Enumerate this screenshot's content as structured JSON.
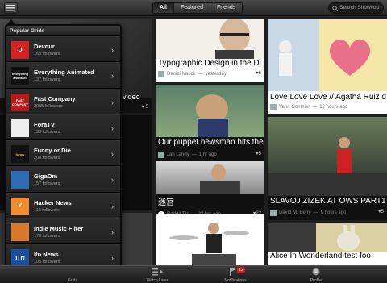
{
  "topbar": {
    "segments": [
      "All",
      "Featured",
      "Friends"
    ],
    "search_placeholder": "Search Showyou"
  },
  "popover": {
    "header": "Popular Grids",
    "items": [
      {
        "name": "Devour",
        "followers": "169 followers",
        "logo_text": "D",
        "logo_bg": "#d42222",
        "logo_fg": "#ffffff",
        "icon": "devour-logo-icon"
      },
      {
        "name": "Everything Animated",
        "followers": "137 followers",
        "logo_text": "everything animated",
        "logo_bg": "#111111",
        "logo_fg": "#ffffff",
        "icon": "everything-animated-logo-icon"
      },
      {
        "name": "Fast Company",
        "followers": "2955 followers",
        "logo_text": "FAST COMPANY",
        "logo_bg": "#b71c1c",
        "logo_fg": "#ffffff",
        "icon": "fast-company-logo-icon"
      },
      {
        "name": "ForaTV",
        "followers": "133 followers",
        "logo_text": "",
        "logo_bg": "#eeeeee",
        "logo_fg": "#333333",
        "icon": "foratv-logo-icon"
      },
      {
        "name": "Funny or Die",
        "followers": "208 followers",
        "logo_text": "funny",
        "logo_bg": "#111111",
        "logo_fg": "#f5c400",
        "icon": "funny-or-die-logo-icon"
      },
      {
        "name": "GigaOm",
        "followers": "157 followers",
        "logo_text": "",
        "logo_bg": "#2e6db4",
        "logo_fg": "#ffffff",
        "icon": "gigaom-logo-icon"
      },
      {
        "name": "Hacker News",
        "followers": "116 followers",
        "logo_text": "Y",
        "logo_bg": "#f28a30",
        "logo_fg": "#ffffff",
        "icon": "hacker-news-logo-icon"
      },
      {
        "name": "Indie Music Filter",
        "followers": "178 followers",
        "logo_text": "",
        "logo_bg": "#d9792e",
        "logo_fg": "#ffffff",
        "icon": "indie-music-filter-logo-icon"
      },
      {
        "name": "Itn News",
        "followers": "105 followers",
        "logo_text": "ITN",
        "logo_bg": "#1a4fa0",
        "logo_fg": "#ffffff",
        "icon": "itn-news-logo-icon"
      }
    ]
  },
  "cards": [
    {
      "title": "Typographic Design in the Di",
      "author": "Daniel Nauck",
      "time": "yesterday",
      "likes": "6"
    },
    {
      "title": "Love Love Love // Agatha Ruiz d",
      "author": "Yann Gonthier",
      "time": "12 hours ago",
      "likes": "5"
    },
    {
      "title": "video",
      "author": "",
      "time": "",
      "likes": "5"
    },
    {
      "title": "Our puppet newsman hits the",
      "author": "Jan Landy",
      "time": "1 hr ago",
      "likes": "5"
    },
    {
      "title": "迷宫",
      "author": "Reddit TV",
      "time": "22 hrs ago",
      "likes": "22"
    },
    {
      "title": "SLAVOJ ZIZEK AT OWS PART1",
      "author": "David M. Berry",
      "time": "9 hours ago",
      "likes": "5"
    },
    {
      "title": "Alice In Wonderland test foo",
      "author": "",
      "time": "",
      "likes": ""
    }
  ],
  "tabbar": {
    "tabs": [
      "Grids",
      "Watch Later",
      "Notifications",
      "Profile"
    ],
    "notifications_badge": "12"
  }
}
